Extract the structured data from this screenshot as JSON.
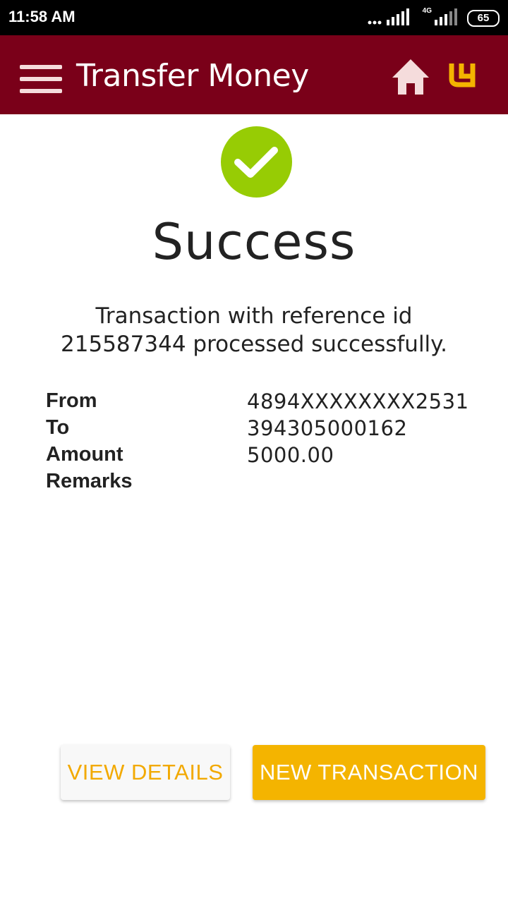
{
  "status_bar": {
    "time": "11:58 AM",
    "network_label": "4G",
    "battery": "65"
  },
  "app_bar": {
    "title": "Transfer Money",
    "menu_icon": "hamburger-menu-icon",
    "home_icon": "home-icon",
    "logo_icon": "bank-logo-icon"
  },
  "result": {
    "status_icon": "check-icon",
    "title": "Success",
    "message_line1": "Transaction with reference id",
    "message_line2": "215587344 processed successfully."
  },
  "details": [
    {
      "label": "From",
      "value": "4894XXXXXXXX2531"
    },
    {
      "label": "To",
      "value": "394305000162"
    },
    {
      "label": "Amount",
      "value": "5000.00"
    },
    {
      "label": "Remarks",
      "value": ""
    }
  ],
  "actions": {
    "view_details": "VIEW DETAILS",
    "new_transaction": "NEW TRANSACTION"
  },
  "colors": {
    "app_bar": "#7a0019",
    "success_green": "#97cc04",
    "accent_orange": "#f4b400"
  }
}
